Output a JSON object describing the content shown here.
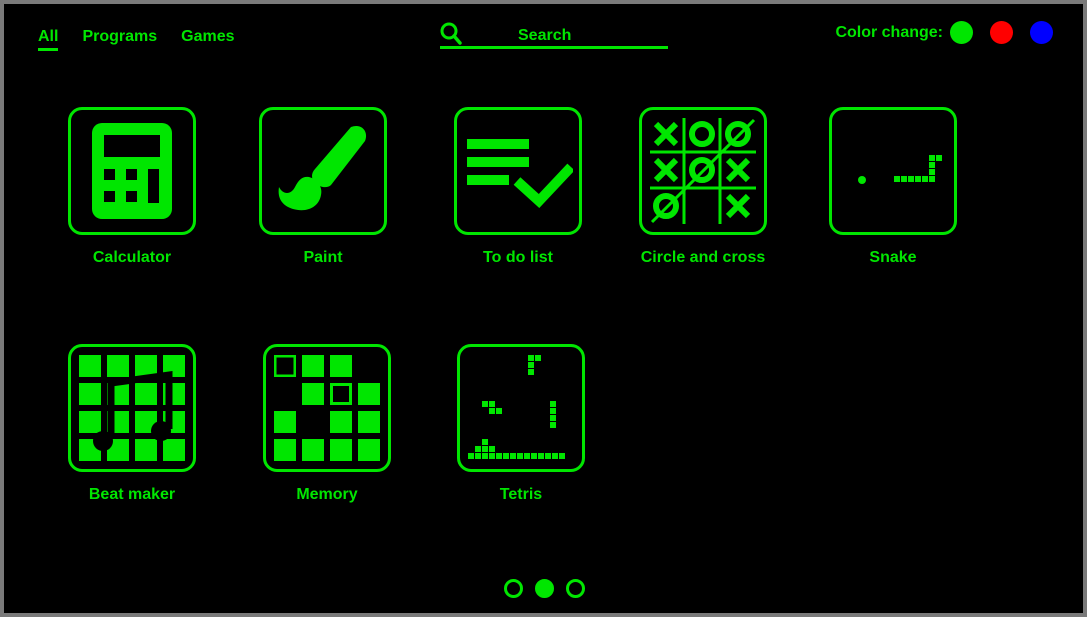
{
  "nav": {
    "tabs": [
      {
        "label": "All",
        "active": true
      },
      {
        "label": "Programs",
        "active": false
      },
      {
        "label": "Games",
        "active": false
      }
    ]
  },
  "search": {
    "placeholder": "Search",
    "icon": "search-icon"
  },
  "color_change": {
    "label": "Color change:",
    "options": [
      {
        "name": "green",
        "color": "#00e600"
      },
      {
        "name": "red",
        "color": "#ff0000"
      },
      {
        "name": "blue",
        "color": "#0000ff"
      }
    ]
  },
  "theme": {
    "accent": "#00e600",
    "background": "#000000"
  },
  "apps": [
    {
      "label": "Calculator",
      "icon": "calculator-icon"
    },
    {
      "label": "Paint",
      "icon": "paintbrush-icon"
    },
    {
      "label": "To do list",
      "icon": "checklist-icon"
    },
    {
      "label": "Circle and cross",
      "icon": "tic-tac-toe-icon"
    },
    {
      "label": "Snake",
      "icon": "snake-icon"
    },
    {
      "label": "Beat maker",
      "icon": "music-grid-icon"
    },
    {
      "label": "Memory",
      "icon": "memory-grid-icon"
    },
    {
      "label": "Tetris",
      "icon": "tetris-icon"
    }
  ],
  "pagination": {
    "pages": 3,
    "current": 2
  }
}
